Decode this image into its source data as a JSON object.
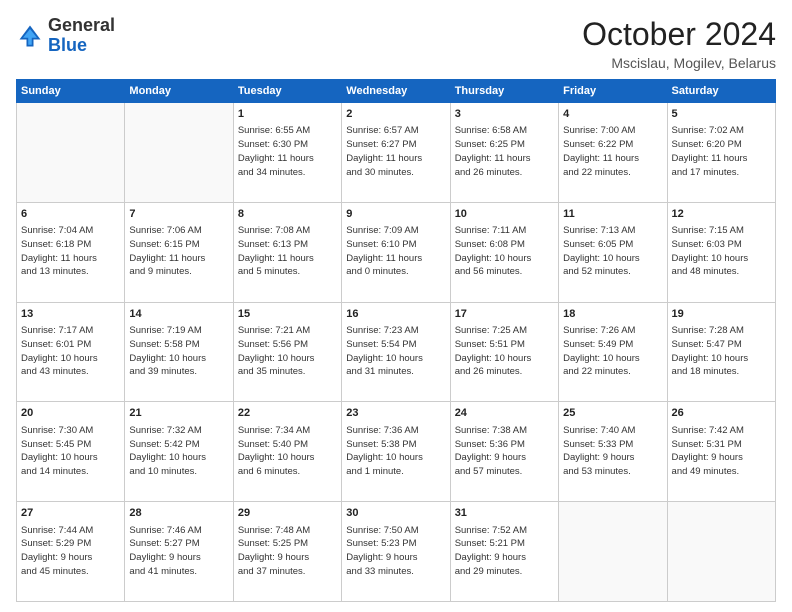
{
  "header": {
    "logo_general": "General",
    "logo_blue": "Blue",
    "month_title": "October 2024",
    "location": "Mscislau, Mogilev, Belarus"
  },
  "days_of_week": [
    "Sunday",
    "Monday",
    "Tuesday",
    "Wednesday",
    "Thursday",
    "Friday",
    "Saturday"
  ],
  "weeks": [
    [
      {
        "day": "",
        "info": ""
      },
      {
        "day": "",
        "info": ""
      },
      {
        "day": "1",
        "info": "Sunrise: 6:55 AM\nSunset: 6:30 PM\nDaylight: 11 hours\nand 34 minutes."
      },
      {
        "day": "2",
        "info": "Sunrise: 6:57 AM\nSunset: 6:27 PM\nDaylight: 11 hours\nand 30 minutes."
      },
      {
        "day": "3",
        "info": "Sunrise: 6:58 AM\nSunset: 6:25 PM\nDaylight: 11 hours\nand 26 minutes."
      },
      {
        "day": "4",
        "info": "Sunrise: 7:00 AM\nSunset: 6:22 PM\nDaylight: 11 hours\nand 22 minutes."
      },
      {
        "day": "5",
        "info": "Sunrise: 7:02 AM\nSunset: 6:20 PM\nDaylight: 11 hours\nand 17 minutes."
      }
    ],
    [
      {
        "day": "6",
        "info": "Sunrise: 7:04 AM\nSunset: 6:18 PM\nDaylight: 11 hours\nand 13 minutes."
      },
      {
        "day": "7",
        "info": "Sunrise: 7:06 AM\nSunset: 6:15 PM\nDaylight: 11 hours\nand 9 minutes."
      },
      {
        "day": "8",
        "info": "Sunrise: 7:08 AM\nSunset: 6:13 PM\nDaylight: 11 hours\nand 5 minutes."
      },
      {
        "day": "9",
        "info": "Sunrise: 7:09 AM\nSunset: 6:10 PM\nDaylight: 11 hours\nand 0 minutes."
      },
      {
        "day": "10",
        "info": "Sunrise: 7:11 AM\nSunset: 6:08 PM\nDaylight: 10 hours\nand 56 minutes."
      },
      {
        "day": "11",
        "info": "Sunrise: 7:13 AM\nSunset: 6:05 PM\nDaylight: 10 hours\nand 52 minutes."
      },
      {
        "day": "12",
        "info": "Sunrise: 7:15 AM\nSunset: 6:03 PM\nDaylight: 10 hours\nand 48 minutes."
      }
    ],
    [
      {
        "day": "13",
        "info": "Sunrise: 7:17 AM\nSunset: 6:01 PM\nDaylight: 10 hours\nand 43 minutes."
      },
      {
        "day": "14",
        "info": "Sunrise: 7:19 AM\nSunset: 5:58 PM\nDaylight: 10 hours\nand 39 minutes."
      },
      {
        "day": "15",
        "info": "Sunrise: 7:21 AM\nSunset: 5:56 PM\nDaylight: 10 hours\nand 35 minutes."
      },
      {
        "day": "16",
        "info": "Sunrise: 7:23 AM\nSunset: 5:54 PM\nDaylight: 10 hours\nand 31 minutes."
      },
      {
        "day": "17",
        "info": "Sunrise: 7:25 AM\nSunset: 5:51 PM\nDaylight: 10 hours\nand 26 minutes."
      },
      {
        "day": "18",
        "info": "Sunrise: 7:26 AM\nSunset: 5:49 PM\nDaylight: 10 hours\nand 22 minutes."
      },
      {
        "day": "19",
        "info": "Sunrise: 7:28 AM\nSunset: 5:47 PM\nDaylight: 10 hours\nand 18 minutes."
      }
    ],
    [
      {
        "day": "20",
        "info": "Sunrise: 7:30 AM\nSunset: 5:45 PM\nDaylight: 10 hours\nand 14 minutes."
      },
      {
        "day": "21",
        "info": "Sunrise: 7:32 AM\nSunset: 5:42 PM\nDaylight: 10 hours\nand 10 minutes."
      },
      {
        "day": "22",
        "info": "Sunrise: 7:34 AM\nSunset: 5:40 PM\nDaylight: 10 hours\nand 6 minutes."
      },
      {
        "day": "23",
        "info": "Sunrise: 7:36 AM\nSunset: 5:38 PM\nDaylight: 10 hours\nand 1 minute."
      },
      {
        "day": "24",
        "info": "Sunrise: 7:38 AM\nSunset: 5:36 PM\nDaylight: 9 hours\nand 57 minutes."
      },
      {
        "day": "25",
        "info": "Sunrise: 7:40 AM\nSunset: 5:33 PM\nDaylight: 9 hours\nand 53 minutes."
      },
      {
        "day": "26",
        "info": "Sunrise: 7:42 AM\nSunset: 5:31 PM\nDaylight: 9 hours\nand 49 minutes."
      }
    ],
    [
      {
        "day": "27",
        "info": "Sunrise: 7:44 AM\nSunset: 5:29 PM\nDaylight: 9 hours\nand 45 minutes."
      },
      {
        "day": "28",
        "info": "Sunrise: 7:46 AM\nSunset: 5:27 PM\nDaylight: 9 hours\nand 41 minutes."
      },
      {
        "day": "29",
        "info": "Sunrise: 7:48 AM\nSunset: 5:25 PM\nDaylight: 9 hours\nand 37 minutes."
      },
      {
        "day": "30",
        "info": "Sunrise: 7:50 AM\nSunset: 5:23 PM\nDaylight: 9 hours\nand 33 minutes."
      },
      {
        "day": "31",
        "info": "Sunrise: 7:52 AM\nSunset: 5:21 PM\nDaylight: 9 hours\nand 29 minutes."
      },
      {
        "day": "",
        "info": ""
      },
      {
        "day": "",
        "info": ""
      }
    ]
  ]
}
